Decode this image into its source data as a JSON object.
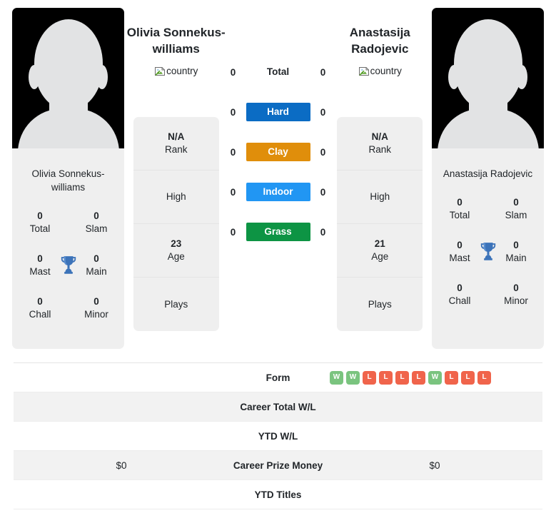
{
  "players": {
    "left": {
      "title": "Olivia Sonnekus-williams",
      "card_name": "Olivia Sonnekus-williams",
      "country_alt": "country",
      "titles": [
        {
          "value": "0",
          "label": "Total"
        },
        {
          "value": "0",
          "label": "Slam"
        },
        {
          "value": "0",
          "label": "Mast"
        },
        {
          "value": "0",
          "label": "Main"
        },
        {
          "value": "0",
          "label": "Chall"
        },
        {
          "value": "0",
          "label": "Minor"
        }
      ],
      "info": [
        {
          "value": "N/A",
          "label": "Rank"
        },
        {
          "value": "",
          "label": "High"
        },
        {
          "value": "23",
          "label": "Age"
        },
        {
          "value": "",
          "label": "Plays"
        }
      ]
    },
    "right": {
      "title": "Anastasija Radojevic",
      "card_name": "Anastasija Radojevic",
      "country_alt": "country",
      "titles": [
        {
          "value": "0",
          "label": "Total"
        },
        {
          "value": "0",
          "label": "Slam"
        },
        {
          "value": "0",
          "label": "Mast"
        },
        {
          "value": "0",
          "label": "Main"
        },
        {
          "value": "0",
          "label": "Chall"
        },
        {
          "value": "0",
          "label": "Minor"
        }
      ],
      "info": [
        {
          "value": "N/A",
          "label": "Rank"
        },
        {
          "value": "",
          "label": "High"
        },
        {
          "value": "21",
          "label": "Age"
        },
        {
          "value": "",
          "label": "Plays"
        }
      ]
    }
  },
  "surfaces": [
    {
      "label": "Total",
      "left": "0",
      "right": "0",
      "color": "transparent",
      "plain": true
    },
    {
      "label": "Hard",
      "left": "0",
      "right": "0",
      "color": "#0b6cc4"
    },
    {
      "label": "Clay",
      "left": "0",
      "right": "0",
      "color": "#e08e0b"
    },
    {
      "label": "Indoor",
      "left": "0",
      "right": "0",
      "color": "#2196f3"
    },
    {
      "label": "Grass",
      "left": "0",
      "right": "0",
      "color": "#0d9444"
    }
  ],
  "comparison_rows": [
    {
      "label": "Form",
      "left": "",
      "right": "",
      "striped": false,
      "type": "form"
    },
    {
      "label": "Career Total W/L",
      "left": "",
      "right": "",
      "striped": true,
      "type": "text"
    },
    {
      "label": "YTD W/L",
      "left": "",
      "right": "",
      "striped": false,
      "type": "text"
    },
    {
      "label": "Career Prize Money",
      "left": "$0",
      "right": "$0",
      "striped": true,
      "type": "text"
    },
    {
      "label": "YTD Titles",
      "left": "",
      "right": "",
      "striped": false,
      "type": "text"
    }
  ],
  "form": {
    "results": [
      "W",
      "W",
      "L",
      "L",
      "L",
      "L",
      "W",
      "L",
      "L",
      "L"
    ],
    "win_color": "#7ac47f",
    "loss_color": "#f0644b"
  },
  "icons": {
    "trophy": "trophy-icon",
    "broken_image": "broken-image-icon"
  }
}
